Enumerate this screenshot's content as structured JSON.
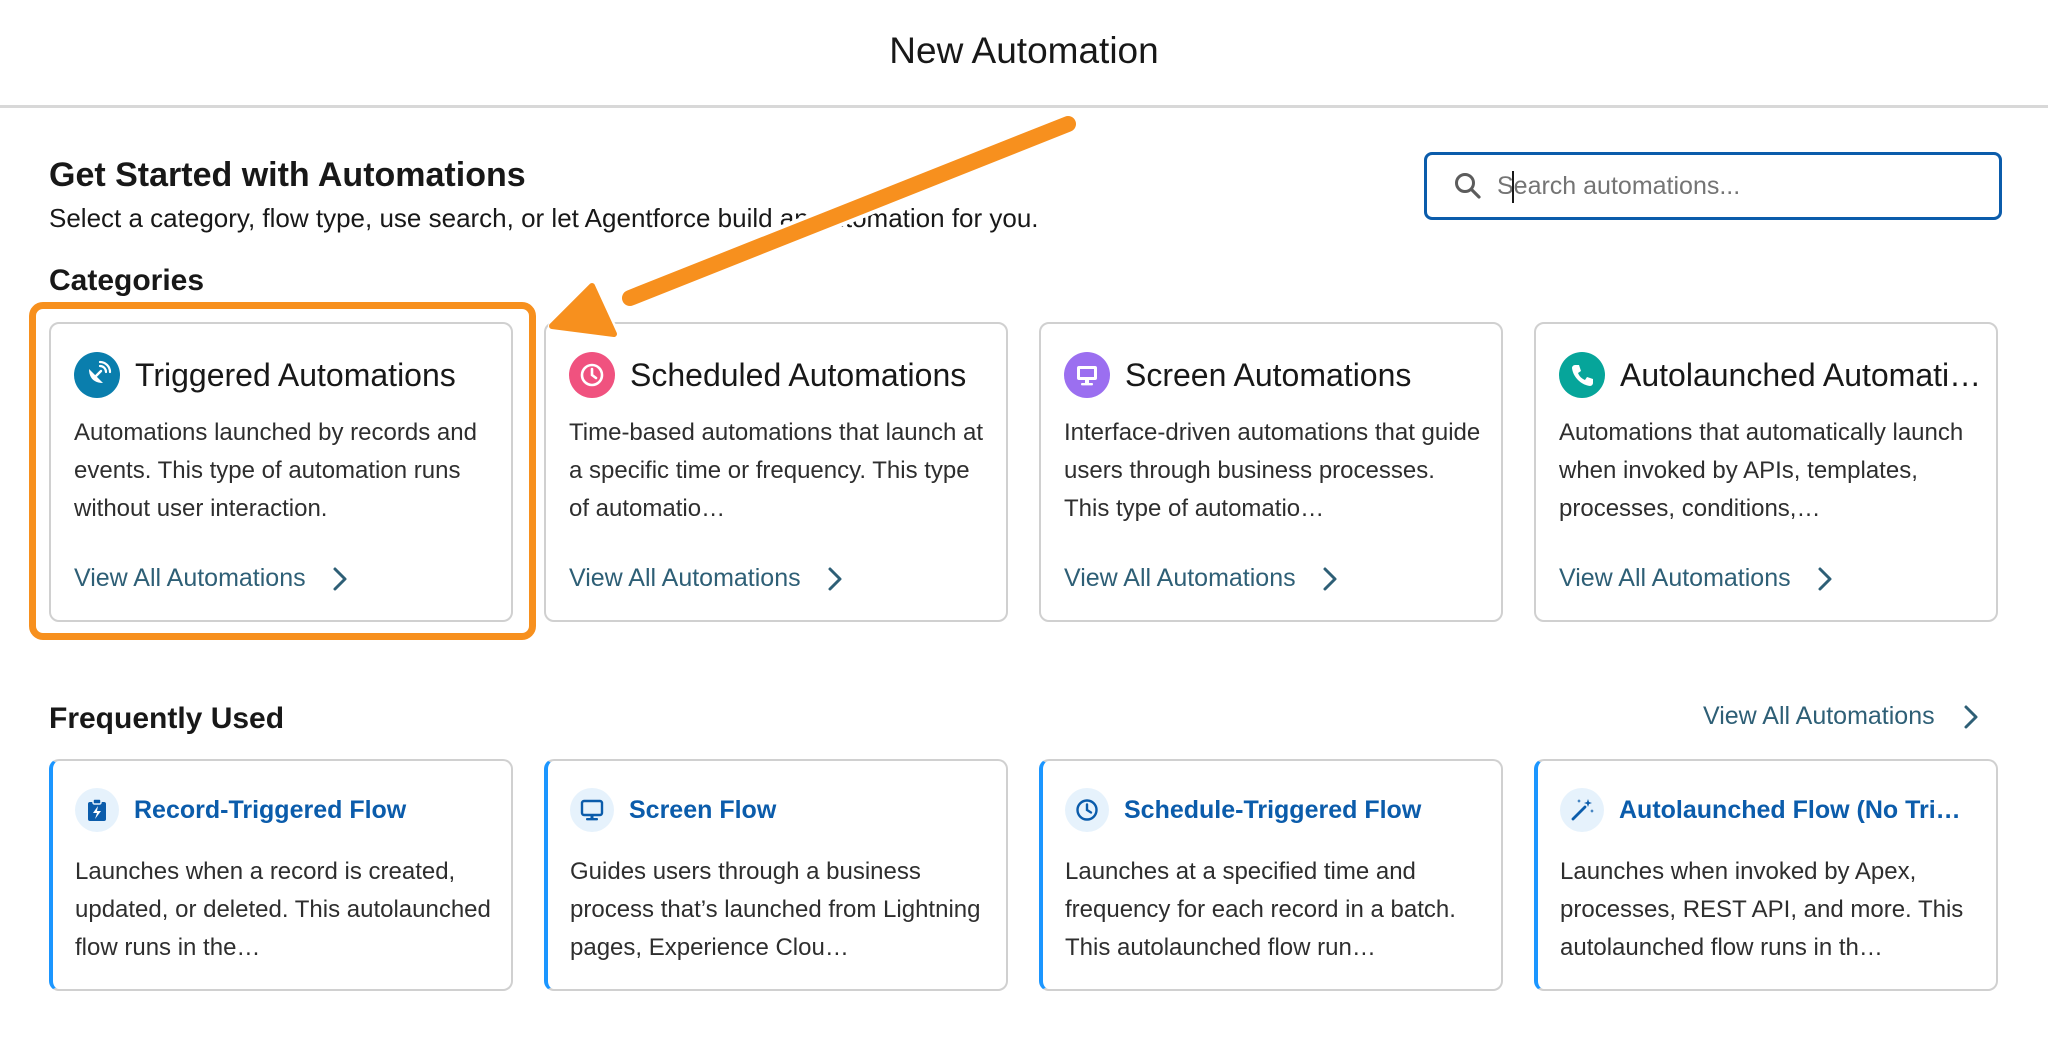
{
  "header": {
    "title": "New Automation"
  },
  "intro": {
    "title": "Get Started with Automations",
    "subtitle": "Select a category, flow type, use search, or let Agentforce build an automation for you."
  },
  "search": {
    "placeholder": "Search automations..."
  },
  "categories": {
    "title": "Categories",
    "items": [
      {
        "title": "Triggered Automations",
        "description": "Automations launched by records and events. This type of automation runs without user interaction.",
        "link": "View All Automations",
        "icon": "satellite-icon",
        "color": "#0a7ead"
      },
      {
        "title": "Scheduled Automations",
        "description": "Time-based automations that launch at a specific time or frequency. This type of automatio…",
        "link": "View All Automations",
        "icon": "clock-icon",
        "color": "#f0527f"
      },
      {
        "title": "Screen Automations",
        "description": "Interface-driven automations that guide users through business processes. This type of automatio…",
        "link": "View All Automations",
        "icon": "monitor-icon",
        "color": "#9b6ff0"
      },
      {
        "title": "Autolaunched Automati…",
        "description": "Automations that automatically launch when invoked by APIs, templates, processes, conditions,…",
        "link": "View All Automations",
        "icon": "phone-icon",
        "color": "#06a59a"
      }
    ]
  },
  "frequent": {
    "title": "Frequently Used",
    "view_all": "View All Automations",
    "items": [
      {
        "title": "Record-Triggered Flow",
        "description": "Launches when a record is created, updated, or deleted. This autolaunched flow runs in the…",
        "icon": "clipboard-bolt-icon"
      },
      {
        "title": "Screen Flow",
        "description": "Guides users through a business process that’s launched from Lightning pages, Experience Clou…",
        "icon": "monitor-icon"
      },
      {
        "title": "Schedule-Triggered Flow",
        "description": "Launches at a specified time and frequency for each record in a batch. This autolaunched flow run…",
        "icon": "clock-icon"
      },
      {
        "title": "Autolaunched Flow (No Tri…",
        "description": "Launches when invoked by Apex, processes, REST API, and more. This autolaunched flow runs in th…",
        "icon": "magic-wand-icon"
      }
    ]
  },
  "colors": {
    "accent": "#0b5cab",
    "link": "#2e5f76",
    "highlight": "#f7901e"
  }
}
